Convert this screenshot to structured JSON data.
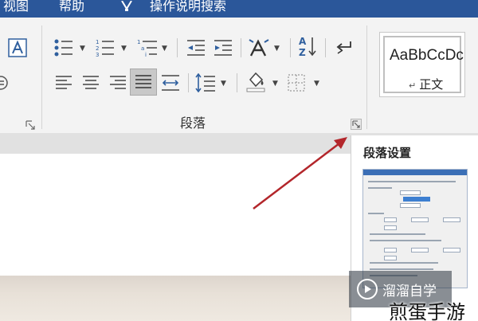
{
  "menu": {
    "view": "视图",
    "help": "帮助",
    "tell_me": "操作说明搜索"
  },
  "ribbon": {
    "paragraph_group_label": "段落"
  },
  "styles": {
    "sample_text": "AaBbCcDc",
    "normal_mark": "↵",
    "normal_label": "正文"
  },
  "tooltip": {
    "title": "段落设置"
  },
  "watermark": {
    "brand_text": "溜溜自学",
    "site_text": "煎蛋手游"
  },
  "colors": {
    "title_blue": "#2b579a",
    "icon_blue": "#2f5f9e",
    "arrow_red": "#b3262b",
    "selected_align_bg": "#c8c8c8"
  },
  "icons": [
    "font-A-icon",
    "clear-format-icon",
    "bullets-icon",
    "numbering-icon",
    "multilevel-list-icon",
    "decrease-indent-icon",
    "increase-indent-icon",
    "asian-layout-icon",
    "sort-icon",
    "show-marks-icon",
    "align-left-icon",
    "align-center-icon",
    "align-right-icon",
    "justify-icon",
    "distributed-icon",
    "line-spacing-icon",
    "shading-icon",
    "borders-icon",
    "dialog-launcher-icon",
    "red-arrow-icon",
    "lightbulb-icon",
    "play-icon"
  ]
}
